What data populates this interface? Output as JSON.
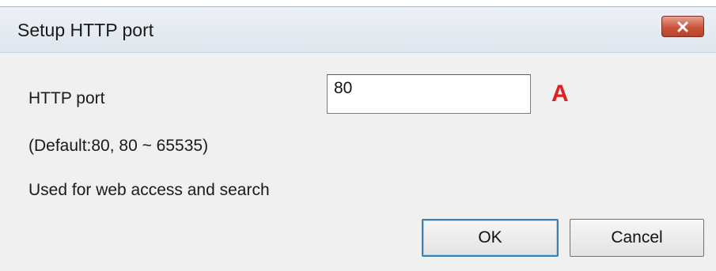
{
  "dialog": {
    "title": "Setup HTTP port",
    "close_icon": "close-icon"
  },
  "form": {
    "port_label": "HTTP port",
    "port_value": "80",
    "default_hint": "(Default:80, 80 ~ 65535)",
    "usage_hint": "Used for web access and search"
  },
  "annotation": {
    "marker": "A",
    "color": "#e02020"
  },
  "buttons": {
    "ok_label": "OK",
    "cancel_label": "Cancel"
  },
  "colors": {
    "close_button": "#c9543a",
    "dialog_background": "#f0f0f0",
    "default_button_border": "#3c7fb1"
  }
}
